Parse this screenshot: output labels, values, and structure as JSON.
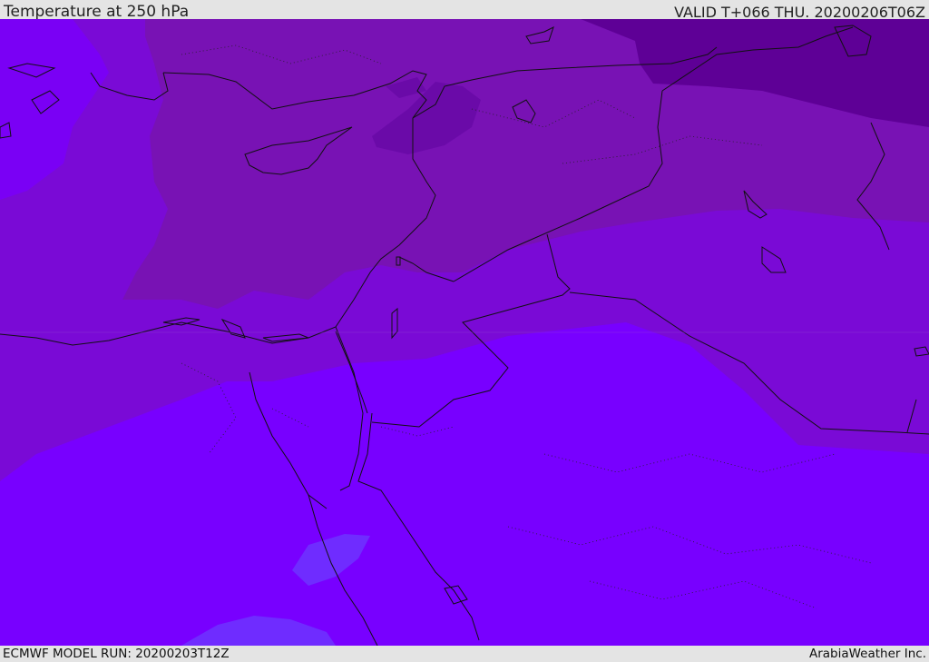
{
  "header": {
    "title": "Temperature at 250 hPa",
    "valid": "VALID T+066 THU. 20200206T06Z"
  },
  "footer": {
    "model_run": "ECMWF MODEL RUN: 20200203T12Z",
    "credit": "ArabiaWeather Inc."
  },
  "map": {
    "colors": {
      "band_coldest": "#5e0096",
      "band_colder": "#7812b4",
      "band_mid": "#7a0ad6",
      "band_warm": "#7800ff",
      "band_warm_lobe": "#6f2cff",
      "band_west": "#7a00f5",
      "coast": "#111111",
      "border": "#111111"
    }
  }
}
